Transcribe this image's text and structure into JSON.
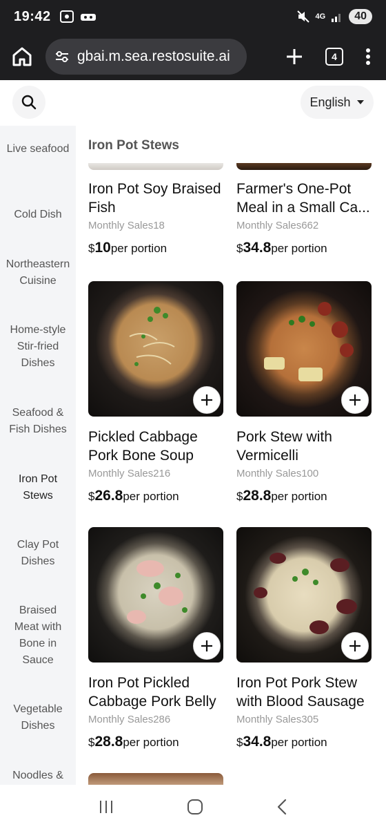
{
  "status": {
    "time": "19:42",
    "network": "4G",
    "battery": "40"
  },
  "browser": {
    "url": "gbai.m.sea.restosuite.ai",
    "tab_count": "4"
  },
  "header": {
    "language": "English"
  },
  "sidebar": {
    "items": [
      {
        "label": "Live seafood"
      },
      {
        "label": "Cold Dish"
      },
      {
        "label": "Northeastern Cuisine"
      },
      {
        "label": "Home-style Stir-fried Dishes"
      },
      {
        "label": "Seafood & Fish Dishes"
      },
      {
        "label": "Iron Pot Stews"
      },
      {
        "label": "Clay Pot Dishes"
      },
      {
        "label": "Braised Meat with Bone in Sauce"
      },
      {
        "label": "Vegetable Dishes"
      },
      {
        "label": "Noodles &"
      }
    ]
  },
  "main": {
    "section_title": "Iron Pot Stews",
    "items": [
      {
        "name": "Iron Pot Soy Braised Fish",
        "sales": "Monthly Sales18",
        "currency": "$",
        "price": "10",
        "unit": "per portion"
      },
      {
        "name": "Farmer's One-Pot Meal in a Small Ca...",
        "sales": "Monthly Sales662",
        "currency": "$",
        "price": "34.8",
        "unit": "per portion"
      },
      {
        "name": "Pickled Cabbage Pork Bone Soup",
        "sales": "Monthly Sales216",
        "currency": "$",
        "price": "26.8",
        "unit": "per portion"
      },
      {
        "name": "Pork Stew with Vermicelli",
        "sales": "Monthly Sales100",
        "currency": "$",
        "price": "28.8",
        "unit": "per portion"
      },
      {
        "name": "Iron Pot Pickled Cabbage Pork Belly",
        "sales": "Monthly Sales286",
        "currency": "$",
        "price": "28.8",
        "unit": "per portion"
      },
      {
        "name": "Iron Pot Pork Stew with Blood Sausage",
        "sales": "Monthly Sales305",
        "currency": "$",
        "price": "34.8",
        "unit": "per portion"
      }
    ]
  },
  "icons": [
    "home-icon",
    "tune-icon",
    "plus-icon",
    "more-icon",
    "search-icon",
    "caret-down-icon",
    "add-icon",
    "recents-icon",
    "home-nav-icon",
    "back-icon"
  ]
}
